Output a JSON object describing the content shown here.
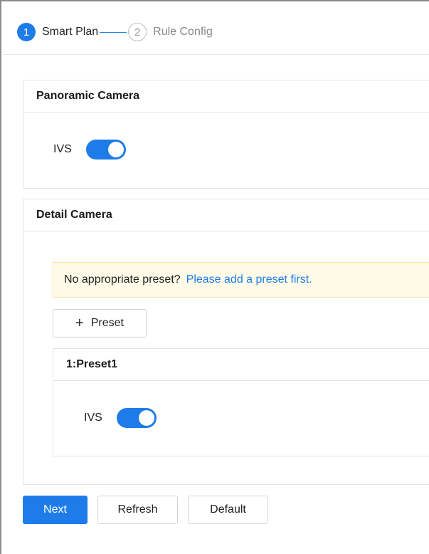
{
  "stepper": {
    "steps": [
      {
        "number": "1",
        "label": "Smart Plan"
      },
      {
        "number": "2",
        "label": "Rule Config"
      }
    ]
  },
  "panoramic": {
    "title": "Panoramic Camera",
    "ivs_label": "IVS",
    "ivs_enabled": true
  },
  "detail": {
    "title": "Detail Camera",
    "notice_text": "No appropriate preset?",
    "notice_link": "Please add a preset first.",
    "add_preset_label": "Preset",
    "preset": {
      "title": "1:Preset1",
      "ivs_label": "IVS",
      "ivs_enabled": true
    }
  },
  "footer": {
    "next_label": "Next",
    "refresh_label": "Refresh",
    "default_label": "Default"
  },
  "colors": {
    "accent": "#1e7ce8",
    "notice_bg": "#fffbe8",
    "notice_border": "#fbe4a8"
  }
}
